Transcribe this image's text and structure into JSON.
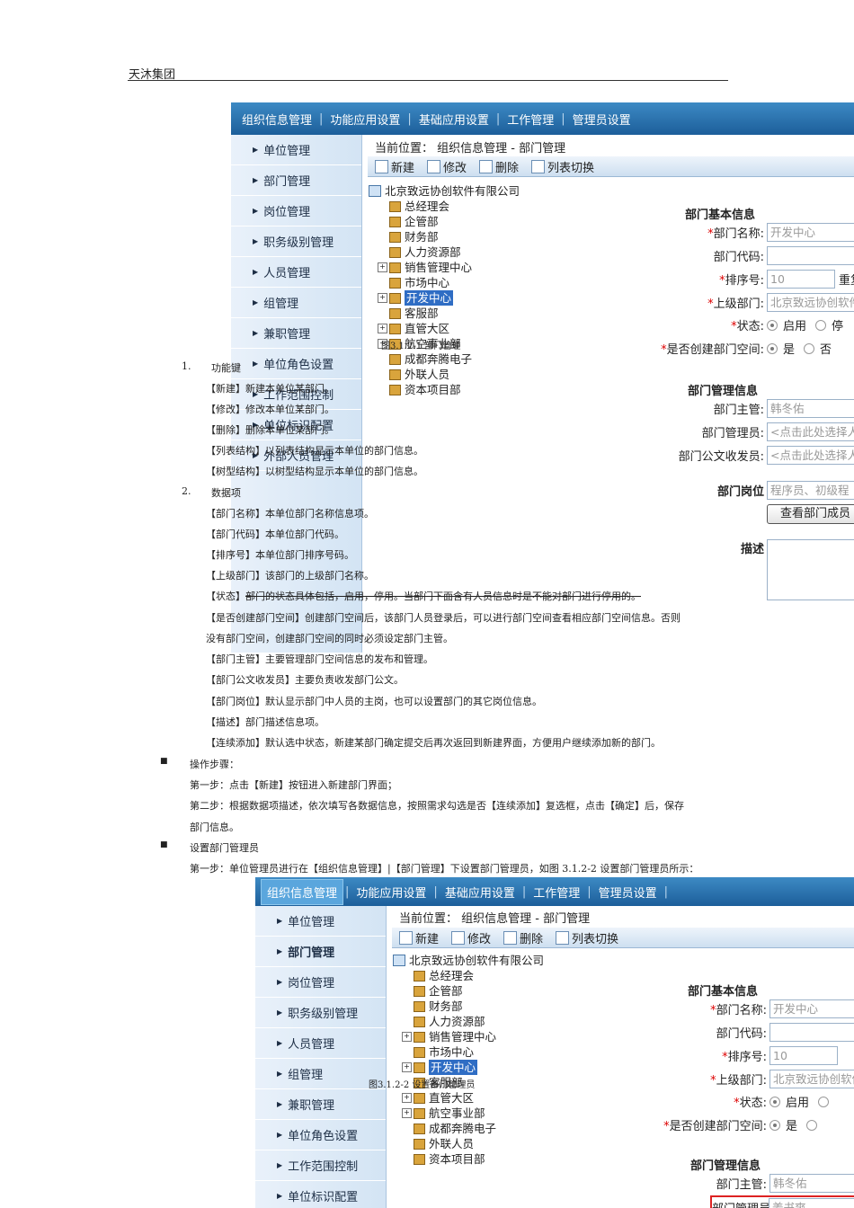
{
  "header": {
    "title": "天沐集团"
  },
  "app": {
    "tabs": [
      "组织信息管理",
      "功能应用设置",
      "基础应用设置",
      "工作管理",
      "管理员设置"
    ],
    "nav": [
      "单位管理",
      "部门管理",
      "岗位管理",
      "职务级别管理",
      "人员管理",
      "组管理",
      "兼职管理",
      "单位角色设置",
      "工作范围控制",
      "单位标识配置",
      "外部人员管理"
    ],
    "crumb": "当前位置：  组织信息管理  - 部门管理",
    "toolbar": {
      "new": "新建",
      "edit": "修改",
      "delete": "删除",
      "switch": "列表切换"
    },
    "tree_root": "北京致远协创软件有限公司",
    "tree": [
      "总经理会",
      "企管部",
      "财务部",
      "人力资源部",
      "销售管理中心",
      "市场中心",
      "开发中心",
      "客服部",
      "直管大区",
      "航空事业部",
      "成都奔腾电子",
      "外联人员",
      "资本项目部"
    ],
    "form": {
      "basic_title": "部门基本信息",
      "name_label": "部门名称:",
      "name_value": "开发中心",
      "code_label": "部门代码:",
      "sort_label": "排序号:",
      "sort_value": "10",
      "sort_extra": "重复",
      "parent_label": "上级部门:",
      "parent_value": "北京致远协创软件",
      "status_label": "状态:",
      "status_on": "启用",
      "status_off": "停",
      "space_label": "是否创建部门空间:",
      "space_yes": "是",
      "space_no": "否",
      "mgmt_title": "部门管理信息",
      "head_label": "部门主管:",
      "head_value": "韩冬佑",
      "admin_label": "部门管理员:",
      "admin_value": "<点击此处选择人",
      "doc_label": "部门公文收发员:",
      "doc_value": "<点击此处选择人",
      "post_label": "部门岗位",
      "post_value": "程序员、初级程",
      "members_button": "查看部门成员",
      "desc_label": "描述"
    },
    "form2": {
      "admin_label": "部门管理员:",
      "admin_value": "姜书爽"
    },
    "overlay1": "图3.1.2-1 部门管理",
    "overlay2": "图3.1.2-2 设置部门管理员"
  },
  "doc": {
    "item1": "1.",
    "item1_label": "功能键",
    "new_tag": "【新建】",
    "new_text": "新建本单位某部门。",
    "edit_tag": "【修改】",
    "edit_text": "修改本单位某部门。",
    "del_tag": "【删除】",
    "del_text": "删除本单位某部门。",
    "list_tag": "【列表结构】",
    "list_text": "以列表结构显示本单位的部门信息。",
    "tree_tag": "【树型结构】",
    "tree_text": "以树型结构显示本单位的部门信息。",
    "item2": "2.",
    "item2_label": "数据项",
    "d1_tag": "【部门名称】",
    "d1_text": "本单位部门名称信息项。",
    "d2_tag": "【部门代码】",
    "d2_text": "本单位部门代码。",
    "d3_tag": "【排序号】",
    "d3_text": "本单位部门排序号码。",
    "d4_tag": "【上级部门】",
    "d4_text": "该部门的上级部门名称。",
    "d5_tag": "【状态】",
    "d5_text": "部门的状态具体包括，启用，停用。当部门下面含有人员信息时是不能对部门进行停用的。",
    "d6_tag": "【是否创建部门空间】",
    "d6_text": "创建部门空间后，该部门人员登录后，可以进行部门空间查看相应部门空间信息。否则",
    "d6_text2": "没有部门空间，创建部门空间的同时必须设定部门主管。",
    "d7_tag": "【部门主管】",
    "d7_text": "主要管理部门空间信息的发布和管理。",
    "d8_tag": "【部门公文收发员】",
    "d8_text": "主要负责收发部门公文。",
    "d9_tag": "【部门岗位】",
    "d9_text": "默认显示部门中人员的主岗，也可以设置部门的其它岗位信息。",
    "d10_tag": "【描述】",
    "d10_text": "部门描述信息项。",
    "d11_tag": "【连续添加】",
    "d11_text": "默认选中状态，新建某部门确定提交后再次返回到新建界面，方便用户继续添加新的部门。",
    "bullet": "■",
    "steps_title": "操作步骤：",
    "step1": "第一步：点击【新建】按钮进入新建部门界面；",
    "step2": "第二步：根据数据项描述，依次填写各数据信息，按照需求勾选是否【连续添加】复选框，点击【确定】后，保存",
    "step2b": "部门信息。",
    "admin_title": "设置部门管理员",
    "admin_step1": "第一步：单位管理员进行在【组织信息管理】|【部门管理】下设置部门管理员，如图 3.1.2-2 设置部门管理员所示："
  }
}
